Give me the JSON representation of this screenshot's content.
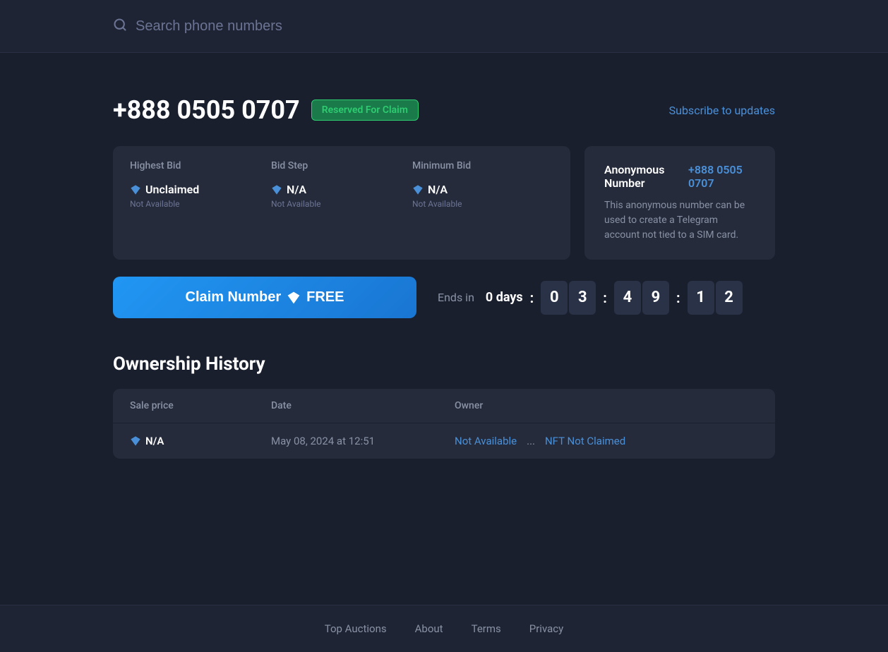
{
  "header": {
    "search_placeholder": "Search phone numbers",
    "search_icon": "🔍"
  },
  "phone": {
    "number": "+888 0505 0707",
    "badge": "Reserved For Claim",
    "subscribe_label": "Subscribe to updates"
  },
  "bid_table": {
    "columns": [
      "Highest Bid",
      "Bid Step",
      "Minimum Bid"
    ],
    "rows": [
      {
        "values": [
          "Unclaimed",
          "N/A",
          "N/A"
        ],
        "subs": [
          "Not Available",
          "Not Available",
          "Not Available"
        ]
      }
    ]
  },
  "anon_card": {
    "title": "Anonymous Number",
    "number": "+888 0505 0707",
    "description": "This anonymous number can be used to create a Telegram account not tied to a SIM card."
  },
  "claim": {
    "button_label": "Claim Number",
    "button_suffix": "FREE",
    "ends_in_label": "Ends in",
    "countdown": {
      "days": "0 days",
      "digits": [
        "0",
        "3",
        "4",
        "9",
        "1",
        "2"
      ]
    }
  },
  "ownership": {
    "title": "Ownership History",
    "columns": [
      "Sale price",
      "Date",
      "Owner"
    ],
    "rows": [
      {
        "price": "N/A",
        "date": "May 08, 2024 at 12:51",
        "owner_link": "Not Available",
        "owner_ellipsis": "...",
        "owner_status": "NFT Not Claimed"
      }
    ]
  },
  "footer": {
    "links": [
      "Top Auctions",
      "About",
      "Terms",
      "Privacy"
    ]
  }
}
